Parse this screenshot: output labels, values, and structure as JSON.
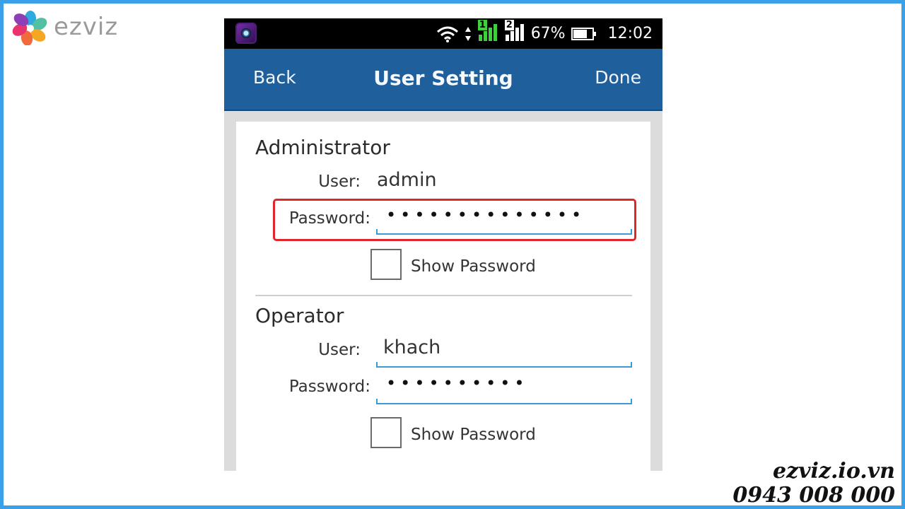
{
  "brand": {
    "logo_text": "ezviz"
  },
  "status_bar": {
    "sim1": "1",
    "sim2": "2",
    "battery": "67%",
    "time": "12:02"
  },
  "navbar": {
    "back": "Back",
    "title": "User Setting",
    "done": "Done"
  },
  "administrator": {
    "title": "Administrator",
    "user_label": "User:",
    "user_value": "admin",
    "password_label": "Password:",
    "password_value": "••••••••••••••",
    "show_password": "Show Password"
  },
  "operator": {
    "title": "Operator",
    "user_label": "User:",
    "user_value": "khach",
    "password_label": "Password:",
    "password_value": "••••••••••",
    "show_password": "Show Password"
  },
  "watermark": {
    "website": "ezviz.io.vn",
    "phone": "0943 008 000"
  },
  "colors": {
    "nav_blue": "#1f5f9c",
    "frame_blue": "#3aa0e8",
    "highlight_red": "#e0262a",
    "underline_blue": "#3a9bd8"
  }
}
